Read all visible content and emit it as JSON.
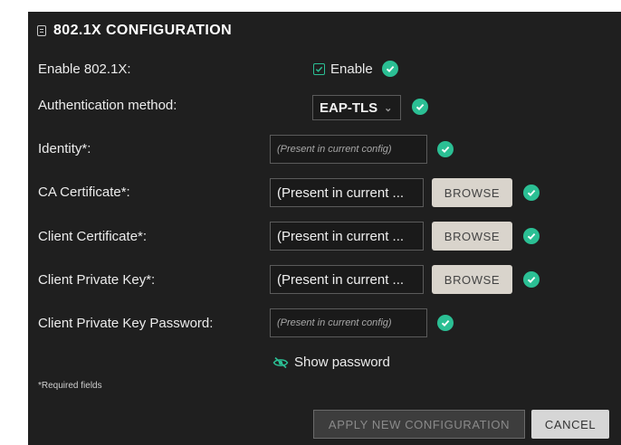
{
  "header": {
    "icon": "document-icon",
    "title": "802.1X CONFIGURATION"
  },
  "colors": {
    "panel_bg": "#1f1f1f",
    "success": "#2bbf94",
    "button_light": "#d9d4cc"
  },
  "fields": {
    "enable": {
      "label": "Enable 802.1X:",
      "checkbox_label": "Enable",
      "checked": true,
      "status": "valid"
    },
    "auth_method": {
      "label": "Authentication method:",
      "value": "EAP-TLS",
      "status": "valid"
    },
    "identity": {
      "label": "Identity*:",
      "placeholder": "(Present in current config)",
      "status": "valid"
    },
    "ca_cert": {
      "label": "CA Certificate*:",
      "value": "(Present in current ...",
      "browse": "BROWSE",
      "status": "valid"
    },
    "client_cert": {
      "label": "Client Certificate*:",
      "value": "(Present in current ...",
      "browse": "BROWSE",
      "status": "valid"
    },
    "client_key": {
      "label": "Client Private Key*:",
      "value": "(Present in current ...",
      "browse": "BROWSE",
      "status": "valid"
    },
    "key_password": {
      "label": "Client Private Key Password:",
      "placeholder": "(Present in current config)",
      "status": "valid"
    }
  },
  "show_password": {
    "label": "Show password",
    "icon": "eye-slash-icon"
  },
  "required_note": "*Required fields",
  "actions": {
    "apply": "APPLY NEW CONFIGURATION",
    "cancel": "CANCEL"
  }
}
